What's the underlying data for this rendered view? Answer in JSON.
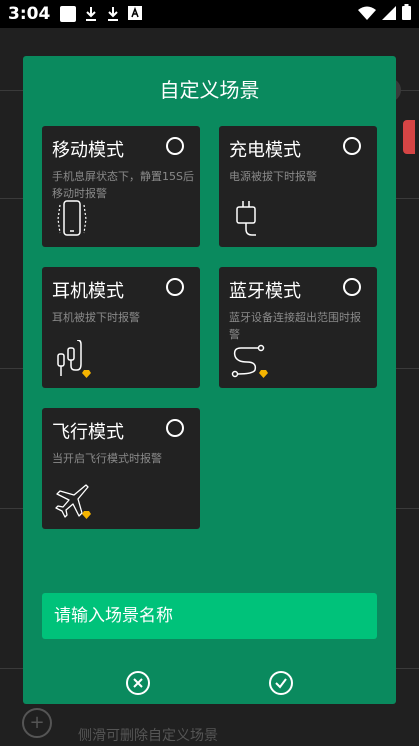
{
  "status_bar": {
    "time": "3:04",
    "icons": [
      "notification-square-icon",
      "download-icon",
      "download-icon",
      "font-a-icon",
      "wifi-icon",
      "signal-icon",
      "battery-icon"
    ]
  },
  "background": {
    "hint": "侧滑可删除自定义场景",
    "plus": "+"
  },
  "dialog": {
    "title": "自定义场景",
    "cards": [
      {
        "title": "移动模式",
        "desc": "手机息屏状态下，静置15S后移动时报警",
        "icon": "phone-vibrate-icon",
        "premium": false
      },
      {
        "title": "充电模式",
        "desc": "电源被拔下时报警",
        "icon": "charger-plug-icon",
        "premium": false
      },
      {
        "title": "耳机模式",
        "desc": "耳机被拔下时报警",
        "icon": "earphones-icon",
        "premium": true
      },
      {
        "title": "蓝牙模式",
        "desc": "蓝牙设备连接超出范围时报警",
        "icon": "bluetooth-route-icon",
        "premium": true
      },
      {
        "title": "飞行模式",
        "desc": "当开启飞行模式时报警",
        "icon": "airplane-icon",
        "premium": true
      }
    ],
    "name_input": {
      "placeholder": "请输入场景名称",
      "value": ""
    },
    "cancel_icon": "cancel-circle-icon",
    "confirm_icon": "confirm-circle-icon"
  },
  "colors": {
    "dialog_bg": "#0a8a5e",
    "card_bg": "#222222",
    "input_bg": "#00c27a",
    "premium_gem": "#f5b400"
  }
}
